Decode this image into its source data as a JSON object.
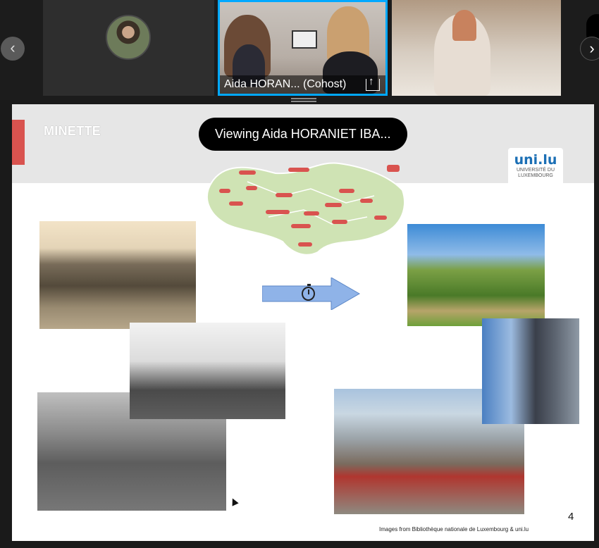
{
  "participants": [
    {
      "label": ""
    },
    {
      "label": "Aida HORAN...  (Cohost)"
    },
    {
      "label": ""
    }
  ],
  "navigation": {
    "prev_glyph": "‹",
    "next_glyph": "›"
  },
  "banner": {
    "text": "Viewing Aida HORANIET IBA..."
  },
  "slide": {
    "title": "MINETTE",
    "logo_text": "uni.lu",
    "logo_sub1": "UNIVERSITÉ DU",
    "logo_sub2": "LUXEMBOURG",
    "credits": "Images from Bibliothèque nationale de Luxembourg & uni.lu",
    "page_number": "4"
  },
  "colors": {
    "accent_border": "#00a8ff",
    "slide_red": "#d9534f",
    "arrow_fill": "#8fb3e8"
  }
}
